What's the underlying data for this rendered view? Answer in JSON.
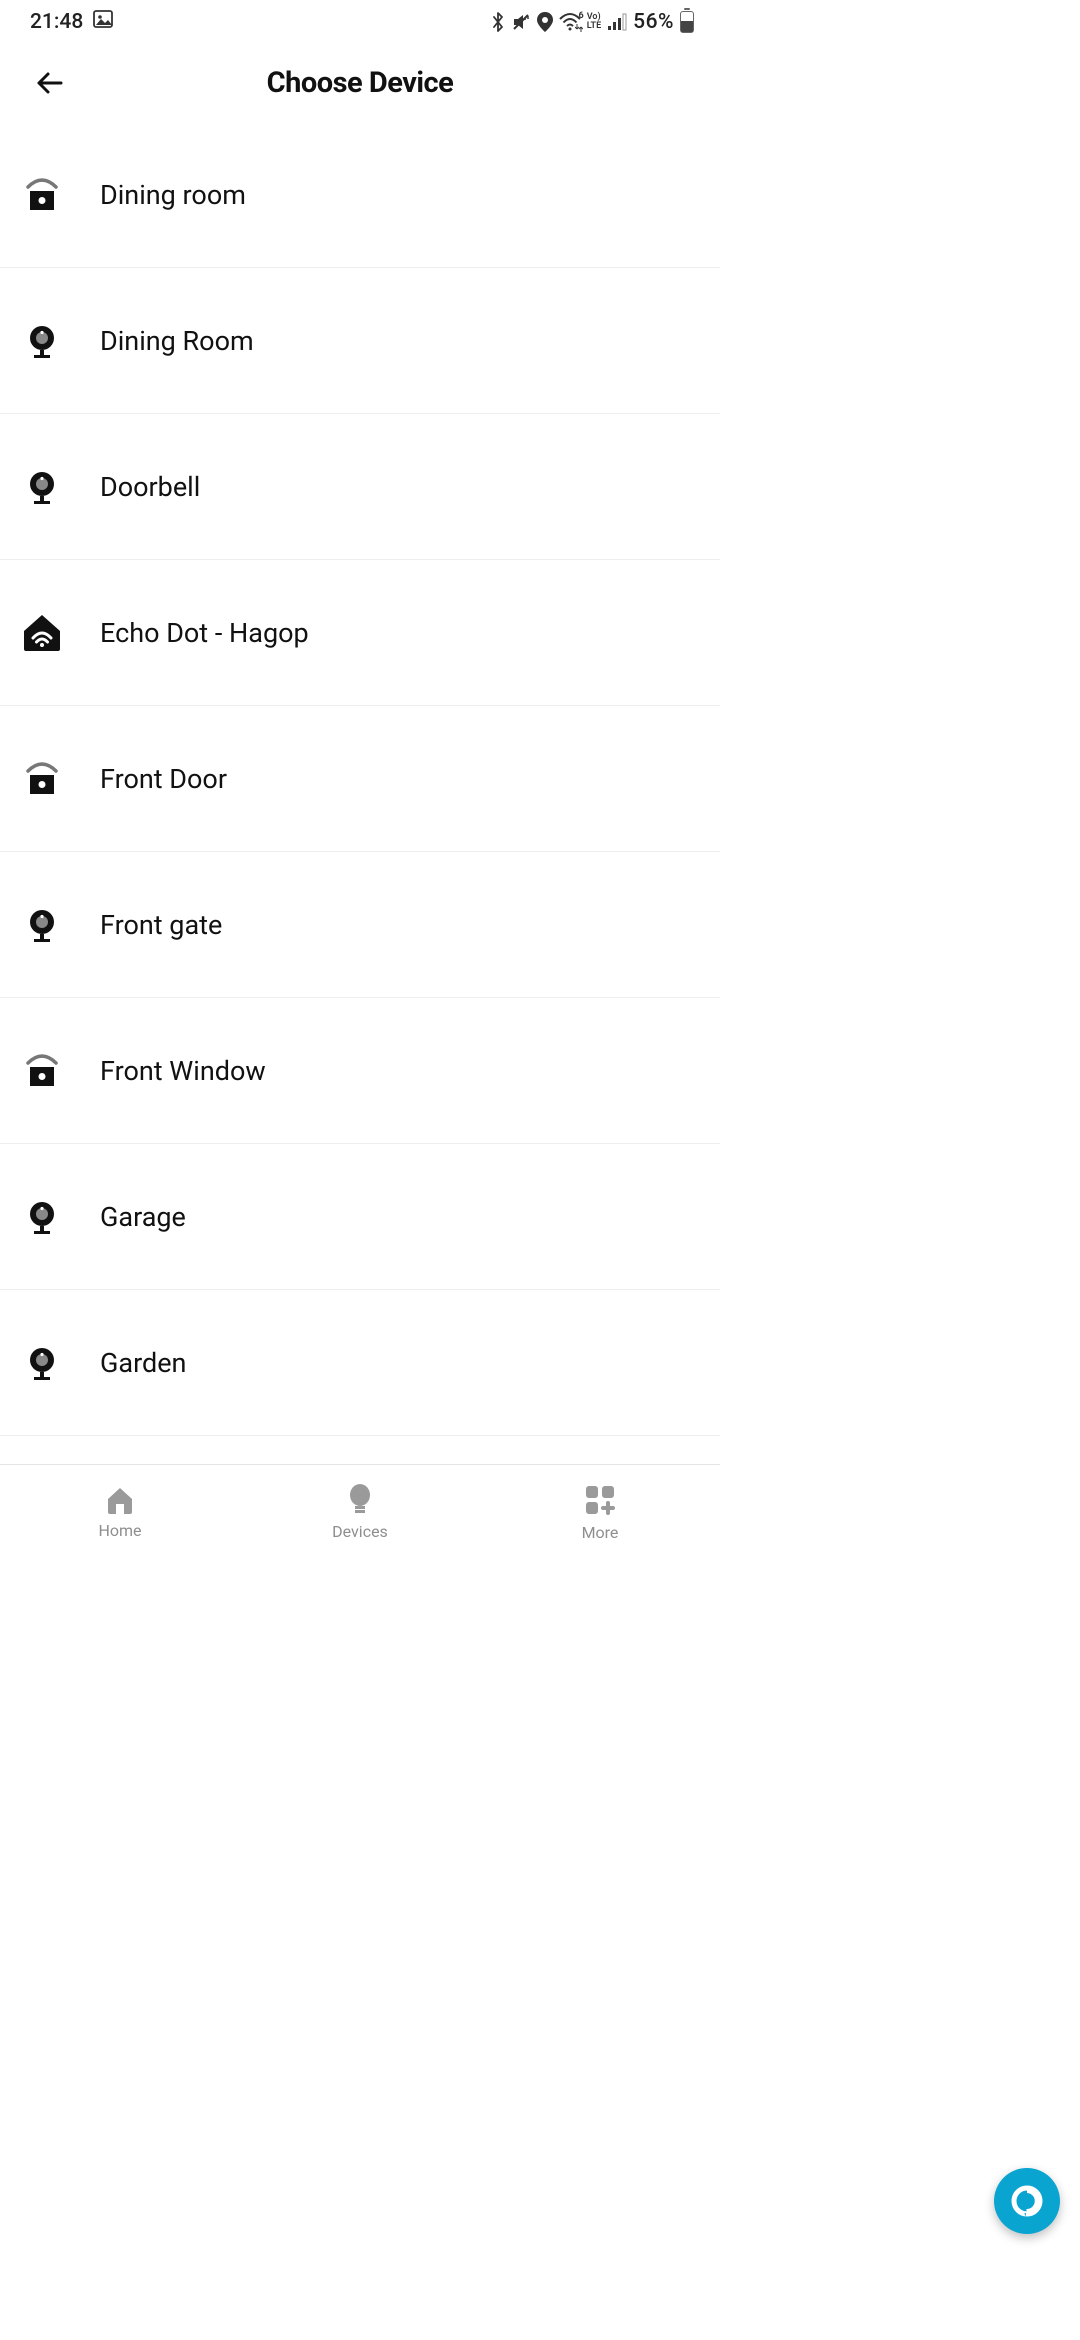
{
  "status": {
    "time": "21:48",
    "battery_pct": "56%"
  },
  "header": {
    "title": "Choose Device"
  },
  "devices": [
    {
      "name": "Dining room",
      "icon": "sensor"
    },
    {
      "name": "Dining Room",
      "icon": "camera"
    },
    {
      "name": "Doorbell",
      "icon": "camera"
    },
    {
      "name": "Echo Dot  - Hagop",
      "icon": "echo"
    },
    {
      "name": "Front Door",
      "icon": "sensor"
    },
    {
      "name": "Front gate",
      "icon": "camera"
    },
    {
      "name": "Front Window",
      "icon": "sensor"
    },
    {
      "name": "Garage",
      "icon": "camera"
    },
    {
      "name": "Garden",
      "icon": "camera"
    }
  ],
  "nav": {
    "home": "Home",
    "devices": "Devices",
    "more": "More"
  }
}
